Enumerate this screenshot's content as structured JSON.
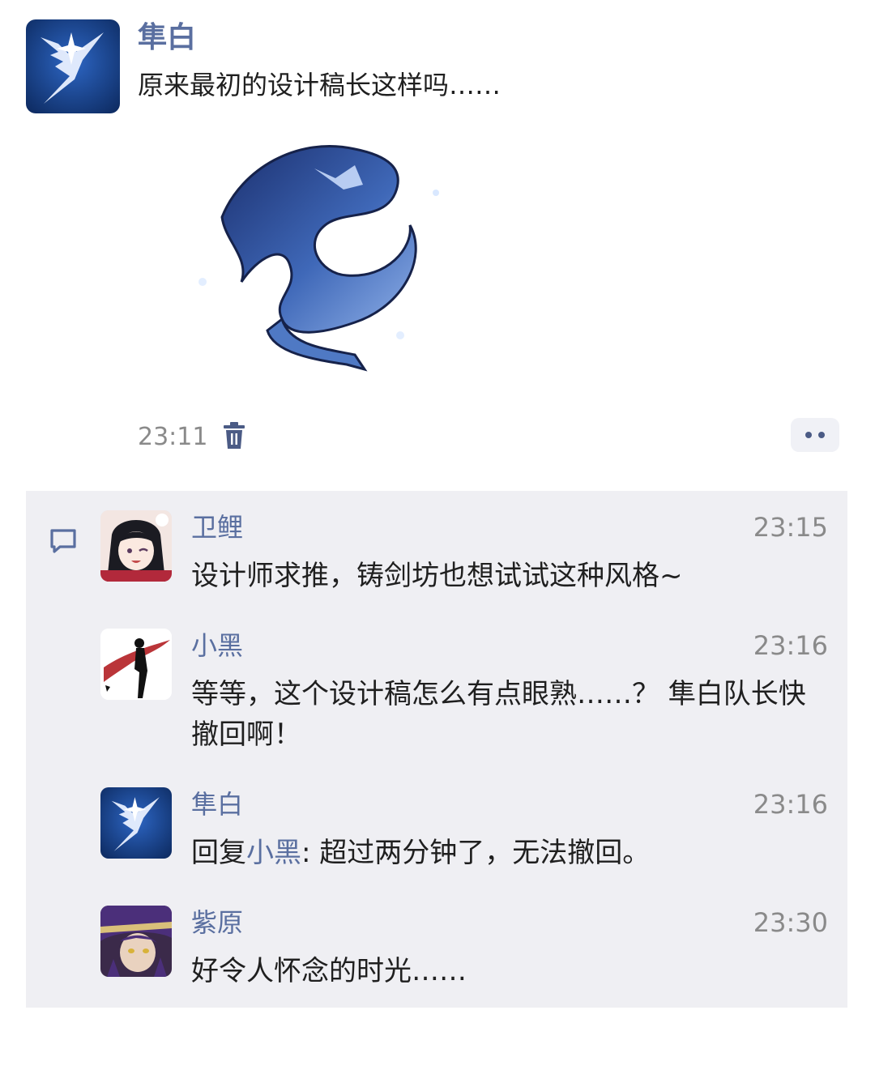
{
  "post": {
    "author": "隼白",
    "text": "原来最初的设计稿长这样吗……",
    "time": "23:11",
    "image_icon": "blue-scarf-image",
    "avatar_icon": "feather-star-emblem"
  },
  "comments": [
    {
      "name": "卫鲤",
      "time": "23:15",
      "text": "设计师求推，铸剑坊也想试试这种风格~",
      "avatar": "dark-haired-girl-avatar"
    },
    {
      "name": "小黑",
      "time": "23:16",
      "text": "等等，这个设计稿怎么有点眼熟……？ 隼白队长快撤回啊！",
      "avatar": "silhouette-red-scarf-avatar"
    },
    {
      "name": "隼白",
      "time": "23:16",
      "reply_prefix": "回复",
      "reply_target": "小黑",
      "reply_text": ": 超过两分钟了，无法撤回。",
      "avatar": "feather-star-emblem"
    },
    {
      "name": "紫原",
      "time": "23:30",
      "text": "好令人怀念的时光……",
      "avatar": "purple-hair-warrior-avatar"
    }
  ],
  "colors": {
    "name": "#5a6fa0",
    "background_comments": "#efeff3",
    "emblem_blue": "#1a3f86"
  }
}
